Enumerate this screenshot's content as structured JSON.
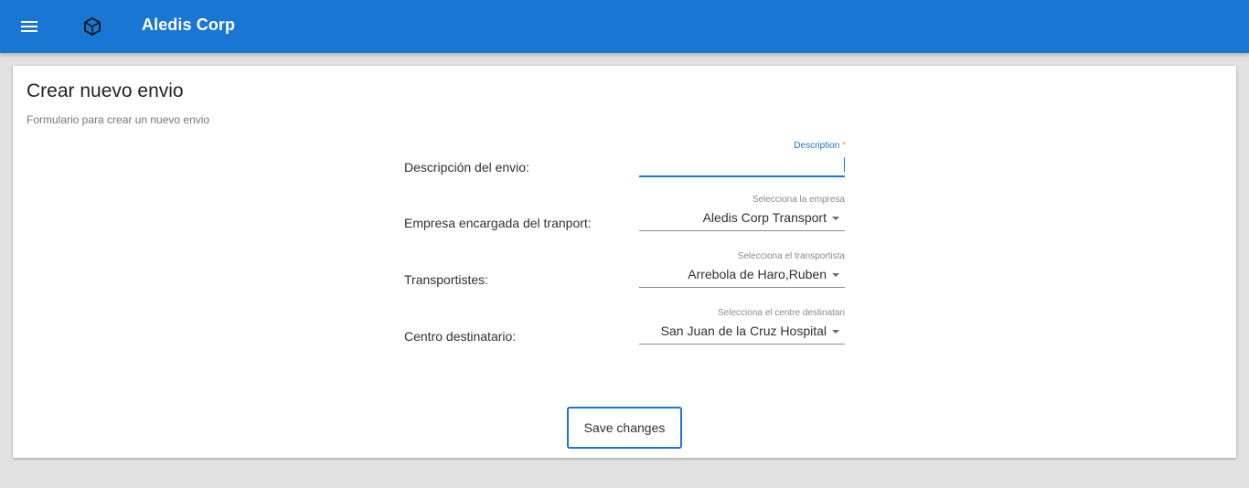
{
  "appbar": {
    "menu_icon": "menu-icon",
    "logo_icon": "cube-icon",
    "title": "Aledis Corp",
    "color": "#1976d2"
  },
  "card": {
    "title": "Crear nuevo envio",
    "subtitle": "Formulario para crear un nuevo envio"
  },
  "form": {
    "description": {
      "row_label": "Descripción del envio:",
      "field_label": "Description",
      "required_marker": "*",
      "value": ""
    },
    "empresa": {
      "row_label": "Empresa encargada del tranport:",
      "field_label": "Selecciona la empresa",
      "value": "Aledis Corp Transport"
    },
    "transportista": {
      "row_label": "Transportistes:",
      "field_label": "Selecciona el transportista",
      "value": "Arrebola de Haro,Ruben"
    },
    "centro": {
      "row_label": "Centro destinatario:",
      "field_label": "Selecciona el centre destinatari",
      "value": "San Juan de la Cruz Hospital"
    }
  },
  "actions": {
    "save_label": "Save changes"
  }
}
